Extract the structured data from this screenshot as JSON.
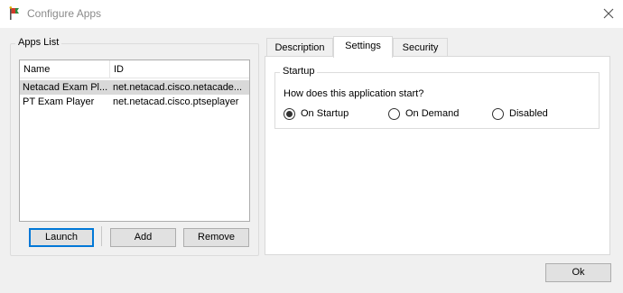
{
  "window": {
    "title": "Configure Apps",
    "app_icon": "flag-icon",
    "close_icon": "close-icon"
  },
  "apps_list": {
    "group_label": "Apps List",
    "columns": [
      "Name",
      "ID"
    ],
    "rows": [
      {
        "name": "Netacad Exam Pl...",
        "id": "net.netacad.cisco.netacade...",
        "selected": true
      },
      {
        "name": "PT Exam Player",
        "id": "net.netacad.cisco.ptseplayer",
        "selected": false
      }
    ],
    "buttons": {
      "launch": "Launch",
      "add": "Add",
      "remove": "Remove"
    }
  },
  "tabs": [
    {
      "label": "Description",
      "active": false
    },
    {
      "label": "Settings",
      "active": true
    },
    {
      "label": "Security",
      "active": false
    }
  ],
  "settings": {
    "startup_group_label": "Startup",
    "question": "How does this application start?",
    "options": [
      {
        "label": "On Startup",
        "checked": true
      },
      {
        "label": "On Demand",
        "checked": false
      },
      {
        "label": "Disabled",
        "checked": false
      }
    ]
  },
  "footer": {
    "ok_label": "Ok"
  },
  "colors": {
    "accent": "#0078d7",
    "selection": "#d9d9d9",
    "window_bg": "#f0f0f0"
  }
}
